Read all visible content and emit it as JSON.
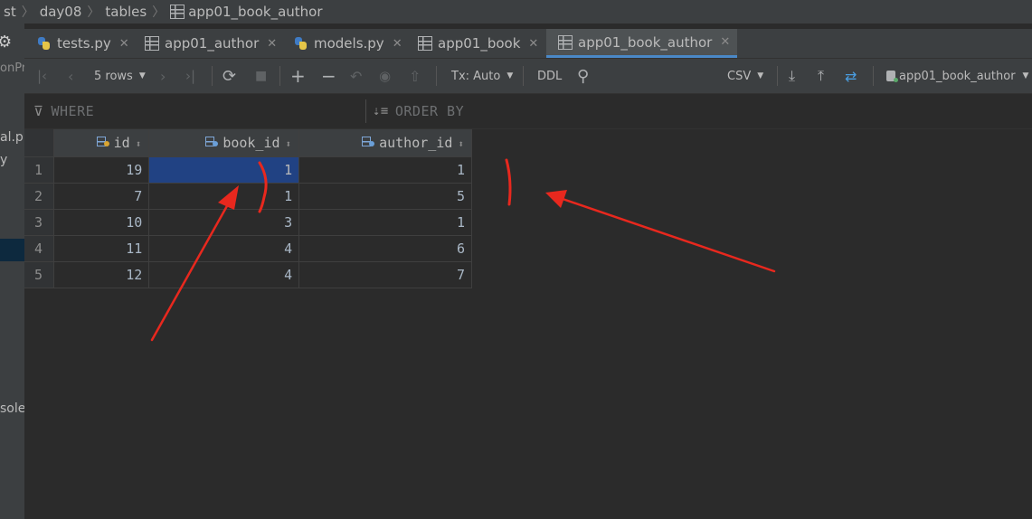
{
  "breadcrumb": [
    "st",
    "day08",
    "tables",
    "app01_book_author"
  ],
  "left_panel": {
    "fragments": [
      "onPr",
      "al.p",
      "y",
      "sole"
    ]
  },
  "tabs": [
    {
      "label": "tests.py",
      "icon": "python-file-icon",
      "active": false
    },
    {
      "label": "app01_author",
      "icon": "table-icon",
      "active": false
    },
    {
      "label": "models.py",
      "icon": "python-file-icon",
      "active": false
    },
    {
      "label": "app01_book",
      "icon": "table-icon",
      "active": false
    },
    {
      "label": "app01_book_author",
      "icon": "table-icon",
      "active": true
    }
  ],
  "toolbar": {
    "rows_label": "5 rows",
    "tx_label": "Tx: Auto",
    "ddl_label": "DDL",
    "csv_label": "CSV",
    "datasource_label": "app01_book_author"
  },
  "filter": {
    "where_label": "WHERE",
    "order_by_label": "ORDER BY"
  },
  "grid": {
    "columns": [
      {
        "name": "id",
        "icon": "primary-key-column-icon"
      },
      {
        "name": "book_id",
        "icon": "foreign-key-column-icon"
      },
      {
        "name": "author_id",
        "icon": "foreign-key-column-icon"
      }
    ],
    "rows": [
      {
        "num": "1",
        "id": "19",
        "book_id": "1",
        "author_id": "1"
      },
      {
        "num": "2",
        "id": "7",
        "book_id": "1",
        "author_id": "5"
      },
      {
        "num": "3",
        "id": "10",
        "book_id": "3",
        "author_id": "1"
      },
      {
        "num": "4",
        "id": "11",
        "book_id": "4",
        "author_id": "6"
      },
      {
        "num": "5",
        "id": "12",
        "book_id": "4",
        "author_id": "7"
      }
    ],
    "selected_cell": {
      "row": 0,
      "column": "book_id"
    }
  },
  "colors": {
    "annotation": "#e8281e",
    "selection": "#214283",
    "active_tab_underline": "#4a88c7"
  }
}
